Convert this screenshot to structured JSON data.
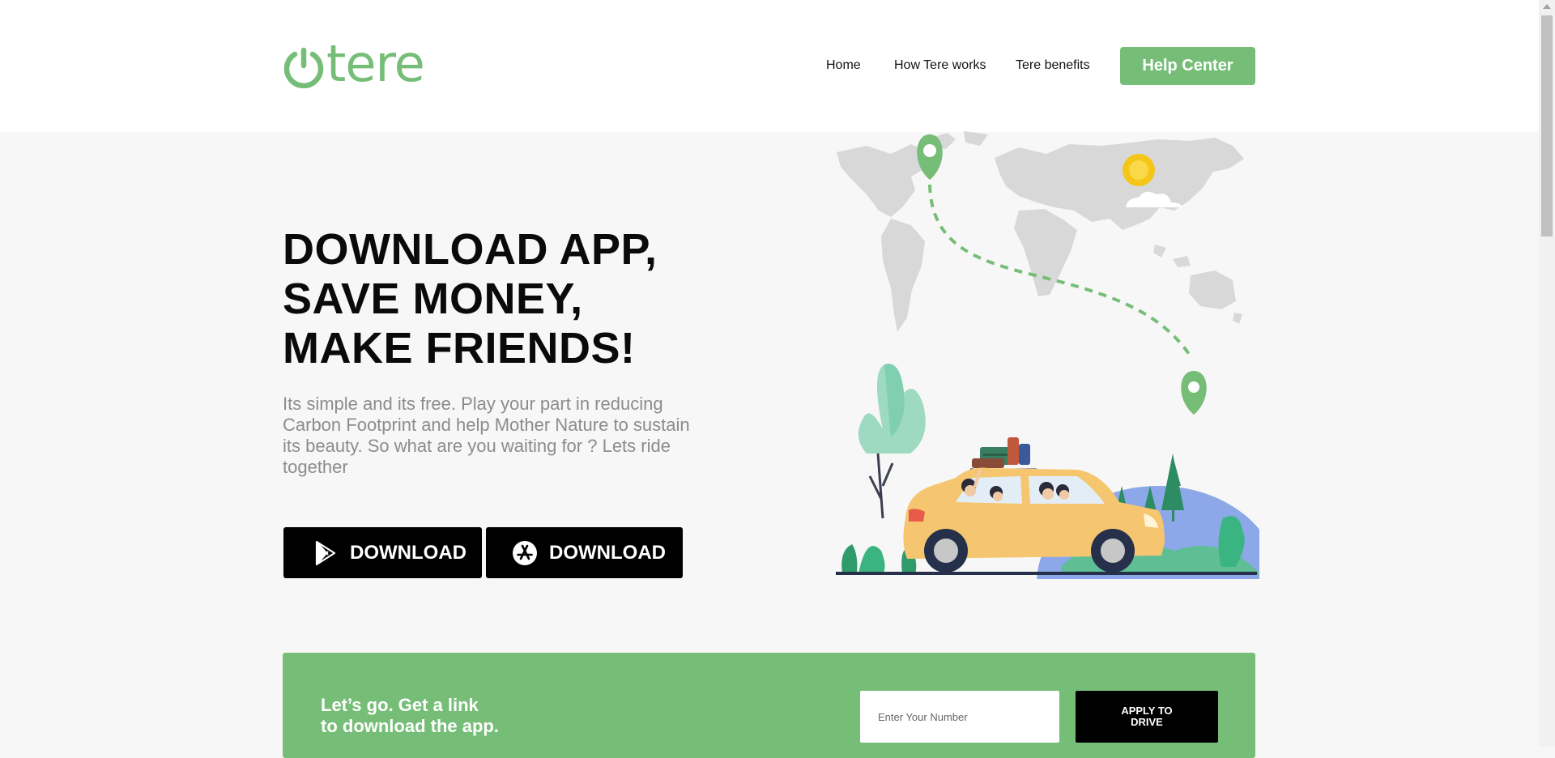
{
  "brand": {
    "name": "tere",
    "color": "#76be78",
    "icon": "power-icon"
  },
  "nav": {
    "items": [
      {
        "label": "Home"
      },
      {
        "label": "How Tere works"
      },
      {
        "label": "Tere benefits"
      }
    ],
    "help_center": "Help Center"
  },
  "hero": {
    "title_lines": [
      "DOWNLOAD APP,",
      "SAVE MONEY,",
      "MAKE FRIENDS!"
    ],
    "description": "Its simple and its free. Play your part in reducing Carbon Footprint and help Mother Nature to sustain its beauty. So what are you waiting for ? Lets ride together",
    "downloads": [
      {
        "label": "DOWNLOAD",
        "icon": "google-play-icon"
      },
      {
        "label": "DOWNLOAD",
        "icon": "app-store-icon"
      }
    ],
    "illustration": "world-map-road-trip-car"
  },
  "cta": {
    "line1": "Let’s go. Get a link",
    "line2": "to download the app.",
    "input_placeholder": "Enter Your Number",
    "button": "APPLY TO DRIVE"
  },
  "colors": {
    "accent": "#76be78",
    "dark": "#000000",
    "muted_text": "#8c8c8c",
    "background": "#f7f7f7"
  }
}
